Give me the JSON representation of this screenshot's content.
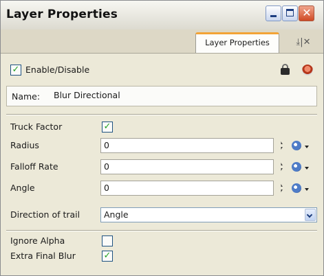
{
  "window": {
    "title": "Layer Properties"
  },
  "tabs": {
    "active_label": "Layer Properties",
    "tools_glyph": "⤓|✕"
  },
  "header": {
    "enable_label": "Enable/Disable",
    "enable_checked": true
  },
  "name": {
    "label": "Name:",
    "value": "Blur Directional"
  },
  "params": {
    "truck_factor_label": "Truck Factor",
    "truck_factor_checked": true,
    "radius_label": "Radius",
    "radius_value": "0",
    "falloff_label": "Falloff Rate",
    "falloff_value": "0",
    "angle_label": "Angle",
    "angle_value": "0",
    "direction_label": "Direction of trail",
    "direction_value": "Angle"
  },
  "options": {
    "ignore_alpha_label": "Ignore Alpha",
    "ignore_alpha_checked": false,
    "extra_final_blur_label": "Extra Final Blur",
    "extra_final_blur_checked": true
  },
  "glyphs": {
    "check": "✓",
    "close": "✕"
  },
  "colors": {
    "tab_accent": "#f3a335",
    "check_green": "#21a121",
    "close_red": "#cf4a25"
  }
}
